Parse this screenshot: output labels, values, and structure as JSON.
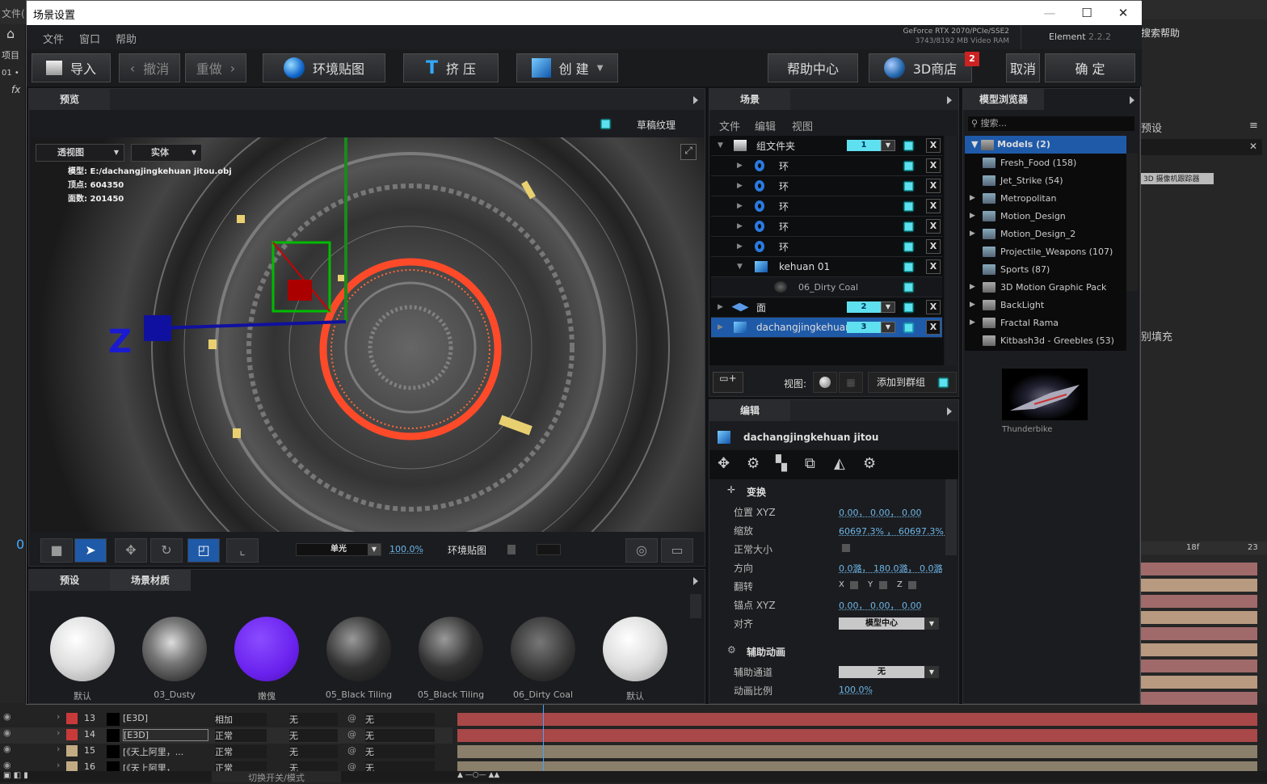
{
  "background_app": {
    "menu_fragment": "文件(",
    "left_items": [
      "项目",
      "01 •",
      "fx"
    ],
    "right_items": [
      "搜索帮助",
      "预设",
      "3D 摄像机跟踪器",
      "别填充"
    ],
    "timeline": {
      "rows": [
        {
          "num": "13",
          "name": "[E3D]",
          "mode": "相加",
          "t1": "无",
          "t2": "无",
          "color": "#c83a3a"
        },
        {
          "num": "14",
          "name": "[E3D]",
          "mode": "正常",
          "t1": "无",
          "t2": "无",
          "color": "#c83a3a"
        },
        {
          "num": "15",
          "name": "[《天上阿里，...",
          "mode": "正常",
          "t1": "无",
          "t2": "无",
          "color": "#c2ab84"
        },
        {
          "num": "16",
          "name": "[《天上阿里，",
          "mode": "正常",
          "t1": "无",
          "t2": "无",
          "color": "#c2ab84"
        }
      ],
      "toggle_label": "切换开关/模式",
      "ruler_label": "18f",
      "ruler_end": "23",
      "time_code": "0"
    }
  },
  "window": {
    "title": "场景设置",
    "minimize": "—",
    "maximize": "☐",
    "close": "✕"
  },
  "menu": [
    "文件",
    "窗口",
    "帮助"
  ],
  "gpu": {
    "line1": "GeForce RTX 2070/PCIe/SSE2",
    "line2": "3743/8192 MB Video RAM"
  },
  "product": {
    "name": "Element",
    "version": "2.2.2"
  },
  "toolbar": {
    "import": "导入",
    "undo": "撤消",
    "redo": "重做",
    "env_map": "环境贴图",
    "extrude": "挤 压",
    "create": "创 建",
    "help_center": "帮助中心",
    "store": "3D商店",
    "store_badge": "2",
    "cancel": "取消",
    "ok": "确 定"
  },
  "preview": {
    "tab": "预览",
    "draft_texture": "草稿纹理",
    "view_mode": "透视图",
    "render_mode": "实体",
    "info": {
      "model_label": "模型:",
      "model": "E:/dachangjingkehuan jitou.obj",
      "vertices_label": "顶点:",
      "vertices": "604350",
      "faces_label": "面数:",
      "faces": "201450"
    },
    "axis_label": "Z",
    "light": "单光",
    "light_pct": "100.0%",
    "env_map": "环境贴图"
  },
  "materials": {
    "tabs": [
      "预设",
      "场景材质"
    ],
    "items": [
      {
        "name": "默认",
        "bg": "radial-gradient(circle at 40% 35%,#fff,#ddd 50%,#999)"
      },
      {
        "name": "03_Dusty",
        "bg": "radial-gradient(circle at 45% 40%,#ddd,#777 40%,#333 80%)"
      },
      {
        "name": "嫩傀",
        "bg": "radial-gradient(circle at 40% 35%,#8a4cff,#6a22ee 60%,#4a10b0)"
      },
      {
        "name": "05_Black Tiling",
        "bg": "radial-gradient(circle at 40% 35%,#999,#333 50%,#111)"
      },
      {
        "name": "05_Black Tiling",
        "bg": "radial-gradient(circle at 40% 35%,#999,#333 50%,#111)"
      },
      {
        "name": "06_Dirty Coal",
        "bg": "radial-gradient(circle at 45% 40%,#777,#333 60%,#111)"
      },
      {
        "name": "默认",
        "bg": "radial-gradient(circle at 40% 35%,#fff,#ddd 50%,#999)"
      }
    ]
  },
  "scene": {
    "tab": "场景",
    "menu": [
      "文件",
      "编辑",
      "视图"
    ],
    "rows": [
      {
        "label": "组文件夹",
        "indent": 0,
        "icon": "folder",
        "group": "1",
        "x": true,
        "exp": "▼"
      },
      {
        "label": "环",
        "indent": 1,
        "icon": "torus",
        "x": true,
        "exp": "▶"
      },
      {
        "label": "环",
        "indent": 1,
        "icon": "torus",
        "x": true,
        "exp": "▶"
      },
      {
        "label": "环",
        "indent": 1,
        "icon": "torus",
        "x": true,
        "exp": "▶"
      },
      {
        "label": "环",
        "indent": 1,
        "icon": "torus",
        "x": true,
        "exp": "▶"
      },
      {
        "label": "环",
        "indent": 1,
        "icon": "torus",
        "x": true,
        "exp": "▶"
      },
      {
        "label": "kehuan 01",
        "indent": 1,
        "icon": "cube",
        "x": true,
        "exp": "▼"
      },
      {
        "label": "06_Dirty Coal",
        "indent": 2,
        "icon": "material",
        "x": false,
        "exp": ""
      },
      {
        "label": "面",
        "indent": 0,
        "icon": "plane",
        "group": "2",
        "x": true,
        "exp": "▶"
      },
      {
        "label": "dachangjingkehuan",
        "indent": 0,
        "icon": "cube",
        "group": "3",
        "x": true,
        "exp": "▶",
        "selected": true
      }
    ],
    "view_label": "视图:",
    "add_to_group": "添加到群组",
    "x_label": "X"
  },
  "edit": {
    "tab": "编辑",
    "object": "dachangjingkehuan jitou",
    "transform": "变换",
    "props": [
      {
        "label": "位置 XYZ",
        "value": "0.00， 0.00， 0.00"
      },
      {
        "label": "缩放",
        "value": "60697.3% ， 60697.3% ，"
      },
      {
        "label": "正常大小",
        "check": true
      },
      {
        "label": "方向",
        "value": "0.0潞， 180.0潞， 0.0潞"
      },
      {
        "label": "翻转",
        "flip": [
          "X",
          "Y",
          "Z"
        ]
      },
      {
        "label": "锚点 XYZ",
        "value": "0.00， 0.00， 0.00"
      },
      {
        "label": "对齐",
        "select": "模型中心"
      }
    ],
    "aux": "辅助动画",
    "aux_props": [
      {
        "label": "辅助通道",
        "select": "无"
      },
      {
        "label": "动画比例",
        "value": "100.0%"
      }
    ]
  },
  "browser": {
    "tab": "模型浏览器",
    "search_placeholder": "搜索...",
    "root": "Models (2)",
    "items": [
      {
        "name": "Fresh_Food (158)",
        "exp": false,
        "blue": true
      },
      {
        "name": "Jet_Strike (54)",
        "exp": false,
        "blue": true
      },
      {
        "name": "Metropolitan",
        "exp": true,
        "blue": true
      },
      {
        "name": "Motion_Design",
        "exp": true,
        "blue": true
      },
      {
        "name": "Motion_Design_2",
        "exp": true,
        "blue": true
      },
      {
        "name": "Projectile_Weapons (107)",
        "exp": false,
        "blue": true
      },
      {
        "name": "Sports (87)",
        "exp": false,
        "blue": true
      },
      {
        "name": "3D Motion Graphic Pack",
        "exp": true,
        "blue": false
      },
      {
        "name": "BackLight",
        "exp": true,
        "blue": false
      },
      {
        "name": "Fractal Rama",
        "exp": true,
        "blue": false
      },
      {
        "name": "Kitbash3d - Greebles (53)",
        "exp": false,
        "blue": false
      }
    ],
    "thumbnail": "Thunderbike"
  },
  "colors": {
    "accent": "#1f5aa8",
    "cyan": "#5fe0f0",
    "ring": "#ff4a2a"
  }
}
